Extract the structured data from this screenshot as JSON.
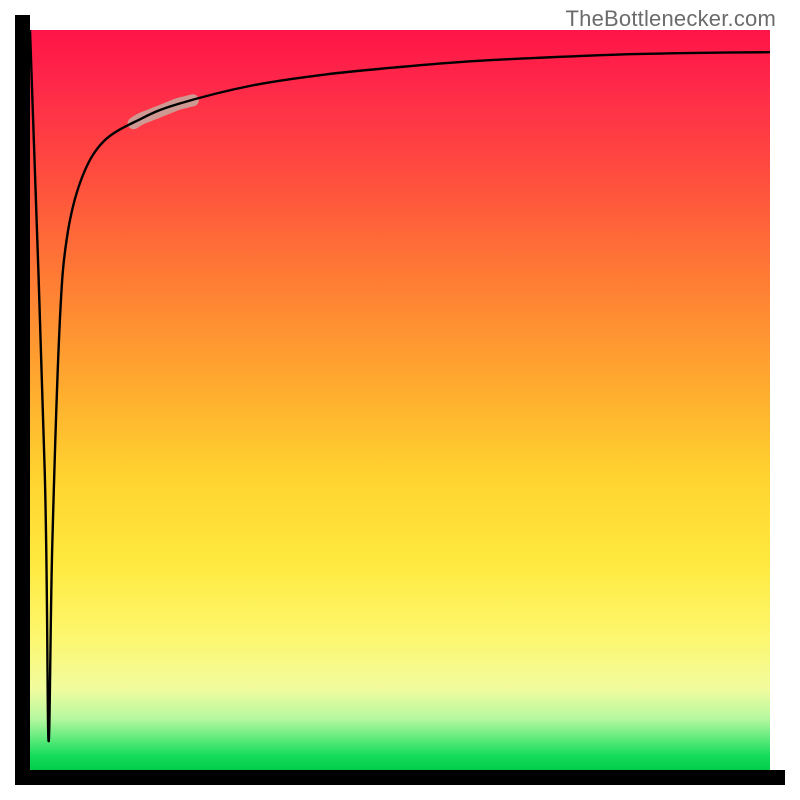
{
  "watermark": "TheBottlenecker.com",
  "colors": {
    "gradient_top": "#ff1448",
    "gradient_mid_upper": "#ff7a35",
    "gradient_mid": "#ffd22f",
    "gradient_mid_lower": "#f1fc9e",
    "gradient_bottom": "#00cd48",
    "axis": "#000000",
    "curve": "#000000",
    "highlight": "#caa199"
  },
  "chart_data": {
    "type": "line",
    "title": "",
    "xlabel": "",
    "ylabel": "",
    "x": [
      0,
      0.02,
      0.025,
      0.03,
      0.04,
      0.05,
      0.07,
      0.1,
      0.15,
      0.2,
      0.3,
      0.4,
      0.5,
      0.6,
      0.7,
      0.8,
      0.9,
      1.0
    ],
    "series": [
      {
        "name": "bottleneck_curve",
        "values": [
          100,
          40,
          4,
          30,
          60,
          72,
          80,
          85,
          88,
          90,
          92.5,
          94,
          95,
          95.8,
          96.3,
          96.7,
          96.9,
          97.0
        ]
      }
    ],
    "highlight_segment": {
      "x_start": 0.14,
      "x_end": 0.22
    },
    "xlim": [
      0,
      1
    ],
    "ylim": [
      0,
      100
    ],
    "grid": false,
    "note": "Values are read off the plot; x is normalized horizontal position, y is percent of vertical height from bottom (approximate). The curve drops sharply to a deep notch near x≈0.025 (y≈4) then rises asymptotically toward ~97 at the right edge."
  }
}
